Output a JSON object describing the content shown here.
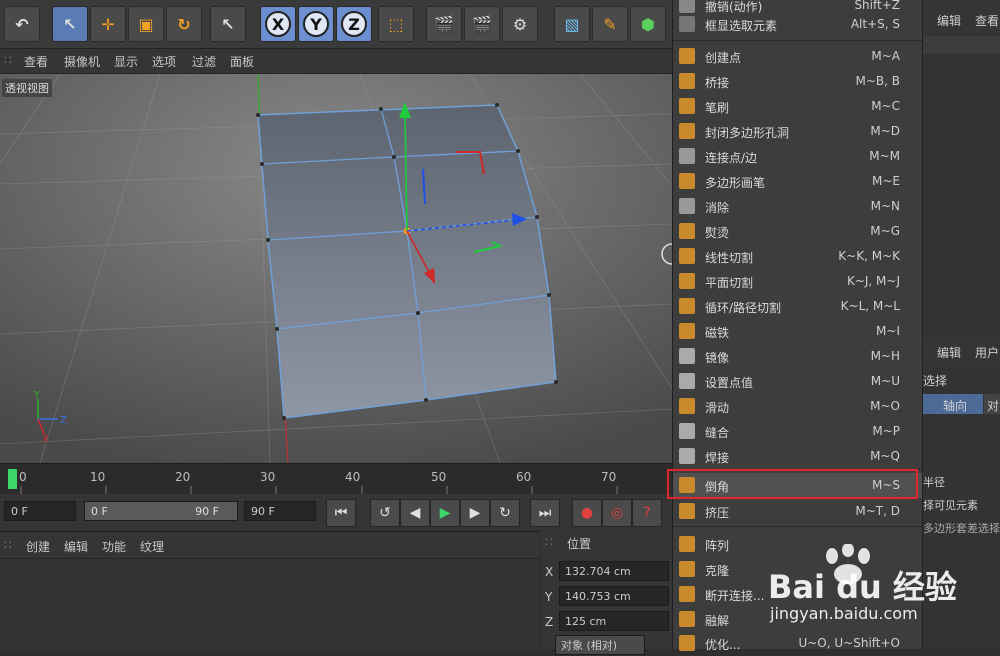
{
  "toolbar": {
    "axis_x": "X",
    "axis_y": "Y",
    "axis_z": "Z"
  },
  "viewport_menu": [
    "查看",
    "摄像机",
    "显示",
    "选项",
    "过滤",
    "面板"
  ],
  "viewport_label": "透视视图",
  "timeline": {
    "ticks": [
      "0",
      "10",
      "20",
      "30",
      "40",
      "50",
      "60",
      "70"
    ]
  },
  "transport": {
    "start_field": "0 F",
    "range_start": "0 F",
    "range_end": "90 F",
    "end_field": "90 F"
  },
  "material_menu": [
    "创建",
    "编辑",
    "功能",
    "纹理"
  ],
  "coords": {
    "header": "位置",
    "x_label": "X",
    "x_value": "132.704 cm",
    "y_label": "Y",
    "y_value": "140.753 cm",
    "z_label": "Z",
    "z_value": "125 cm",
    "mode": "对象 (相对)"
  },
  "context_menu": {
    "items": [
      {
        "label": "撤销(动作)",
        "shortcut": "Shift+Z"
      },
      {
        "label": "框显选取元素",
        "shortcut": "Alt+S, S"
      },
      {
        "label": "创建点",
        "shortcut": "M~A"
      },
      {
        "label": "桥接",
        "shortcut": "M~B, B"
      },
      {
        "label": "笔刷",
        "shortcut": "M~C"
      },
      {
        "label": "封闭多边形孔洞",
        "shortcut": "M~D"
      },
      {
        "label": "连接点/边",
        "shortcut": "M~M"
      },
      {
        "label": "多边形画笔",
        "shortcut": "M~E"
      },
      {
        "label": "消除",
        "shortcut": "M~N"
      },
      {
        "label": "熨烫",
        "shortcut": "M~G"
      },
      {
        "label": "线性切割",
        "shortcut": "K~K, M~K"
      },
      {
        "label": "平面切割",
        "shortcut": "K~J, M~J"
      },
      {
        "label": "循环/路径切割",
        "shortcut": "K~L, M~L"
      },
      {
        "label": "磁铁",
        "shortcut": "M~I"
      },
      {
        "label": "镜像",
        "shortcut": "M~H"
      },
      {
        "label": "设置点值",
        "shortcut": "M~U"
      },
      {
        "label": "滑动",
        "shortcut": "M~O"
      },
      {
        "label": "缝合",
        "shortcut": "M~P"
      },
      {
        "label": "焊接",
        "shortcut": "M~Q"
      },
      {
        "label": "倒角",
        "shortcut": "M~S"
      },
      {
        "label": "挤压",
        "shortcut": "M~T, D"
      },
      {
        "label": "阵列",
        "shortcut": ""
      },
      {
        "label": "克隆",
        "shortcut": ""
      },
      {
        "label": "断开连接...",
        "shortcut": ""
      },
      {
        "label": "融解",
        "shortcut": ""
      },
      {
        "label": "优化...",
        "shortcut": "U~O, U~Shift+O"
      }
    ]
  },
  "right_panel": {
    "top_tab1": "编辑",
    "top_tab2": "查看",
    "mid_tab1": "编辑",
    "mid_tab2": "用户",
    "select_label": "选择",
    "axis_tab": "轴向",
    "obj_tab": "对",
    "radius_label": "半径",
    "visible_label": "择可见元素",
    "poly_label": "多边形套差选择"
  },
  "watermark": {
    "brand": "Bai du 经验",
    "url": "jingyan.baidu.com"
  }
}
